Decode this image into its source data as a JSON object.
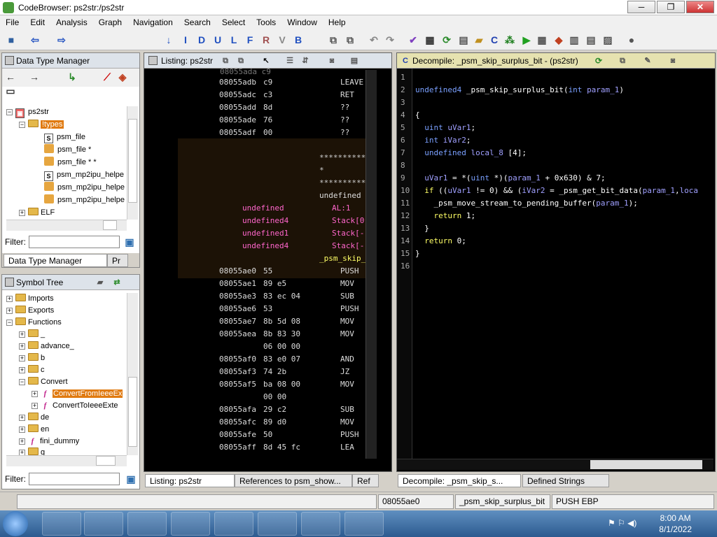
{
  "window": {
    "title": "CodeBrowser: ps2str:/ps2str",
    "min": "─",
    "max": "❐",
    "close": "✕"
  },
  "menu": [
    "File",
    "Edit",
    "Analysis",
    "Graph",
    "Navigation",
    "Search",
    "Select",
    "Tools",
    "Window",
    "Help"
  ],
  "dtm": {
    "title": "Data Type Manager",
    "root": "ps2str",
    "types": "!types",
    "items": [
      "psm_file",
      "psm_file *",
      "psm_file * *",
      "psm_mp2ipu_helpe",
      "psm_mp2ipu_helpe",
      "psm_mp2ipu_helpe"
    ],
    "elf": "ELF",
    "filter_label": "Filter:",
    "tab1": "Data Type Manager",
    "tab2": "Pr"
  },
  "symtree": {
    "title": "Symbol Tree",
    "items": [
      "Imports",
      "Exports",
      "Functions",
      "_",
      "advance_",
      "b",
      "c",
      "Convert",
      "ConvertFromIeeeEx",
      "ConvertToIeeeExte",
      "de",
      "en",
      "fini_dummy",
      "g"
    ],
    "filter_label": "Filter:"
  },
  "listing": {
    "title": "Listing:  ps2str",
    "rows_top": [
      [
        "08055adb",
        "c9",
        "LEAVE"
      ],
      [
        "08055adc",
        "c3",
        "RET"
      ],
      [
        "08055add",
        "8d",
        "??"
      ],
      [
        "08055ade",
        "76",
        "??"
      ],
      [
        "08055adf",
        "00",
        "??"
      ]
    ],
    "header": {
      "stars": "**********",
      "star": "*",
      "fn": "undefined",
      "vars": [
        [
          "undefined",
          "AL:1"
        ],
        [
          "undefined4",
          "Stack[0"
        ],
        [
          "undefined1",
          "Stack[-"
        ],
        [
          "undefined4",
          "Stack[-"
        ]
      ],
      "label": "_psm_skip_"
    },
    "rows": [
      [
        "08055ae0",
        "55",
        "PUSH"
      ],
      [
        "08055ae1",
        "89 e5",
        "MOV"
      ],
      [
        "08055ae3",
        "83 ec 04",
        "SUB"
      ],
      [
        "08055ae6",
        "53",
        "PUSH"
      ],
      [
        "08055ae7",
        "8b 5d 08",
        "MOV"
      ],
      [
        "08055aea",
        "8b 83 30",
        "MOV"
      ],
      [
        "",
        "06 00 00",
        ""
      ],
      [
        "08055af0",
        "83 e0 07",
        "AND"
      ],
      [
        "08055af3",
        "74 2b",
        "JZ"
      ],
      [
        "08055af5",
        "ba 08 00",
        "MOV"
      ],
      [
        "",
        "00 00",
        ""
      ],
      [
        "08055afa",
        "29 c2",
        "SUB"
      ],
      [
        "08055afc",
        "89 d0",
        "MOV"
      ],
      [
        "08055afe",
        "50",
        "PUSH"
      ],
      [
        "08055aff",
        "8d 45 fc",
        "LEA"
      ]
    ]
  },
  "decompile": {
    "title": "Decompile: _psm_skip_surplus_bit -  (ps2str)",
    "lines": [
      "",
      "undefined4 _psm_skip_surplus_bit(int param_1)",
      "",
      "{",
      "  uint uVar1;",
      "  int iVar2;",
      "  undefined local_8 [4];",
      "",
      "  uVar1 = *(uint *)(param_1 + 0x630) & 7;",
      "  if ((uVar1 != 0) && (iVar2 = _psm_get_bit_data(param_1,loca",
      "    _psm_move_stream_to_pending_buffer(param_1);",
      "    return 1;",
      "  }",
      "  return 0;",
      "}",
      ""
    ]
  },
  "bottom_tabs": [
    "Listing:  ps2str",
    "References to psm_show...",
    "Ref",
    "Decompile: _psm_skip_s...",
    "Defined Strings"
  ],
  "status": {
    "addr": "08055ae0",
    "fn": "_psm_skip_surplus_bit",
    "instr": "PUSH EBP"
  },
  "clock": {
    "time": "8:00 AM",
    "date": "8/1/2022"
  },
  "colors": {
    "keyword": "#ffff66",
    "type": "#7aa0ff",
    "var": "#a0a0ff",
    "fn": "#ffffff",
    "dtype": "#ff66cc"
  }
}
